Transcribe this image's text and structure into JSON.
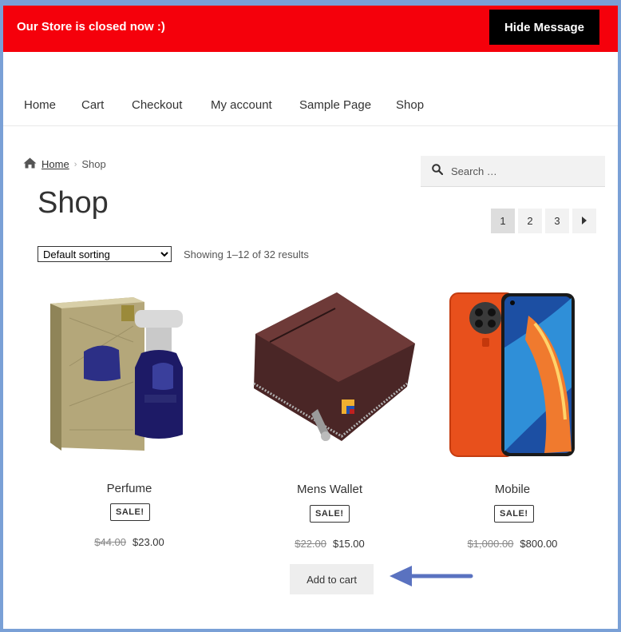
{
  "notice": {
    "message": "Our Store is closed now :)",
    "hide_button": "Hide Message",
    "bar_color": "#f5000b"
  },
  "nav": {
    "items": [
      {
        "label": "Home"
      },
      {
        "label": "Cart"
      },
      {
        "label": "Checkout"
      },
      {
        "label": "My account"
      },
      {
        "label": "Sample Page"
      },
      {
        "label": "Shop"
      }
    ]
  },
  "breadcrumb": {
    "home": "Home",
    "current": "Shop",
    "home_icon": "home-icon"
  },
  "search": {
    "placeholder": "Search …",
    "icon": "search-icon"
  },
  "page_title": "Shop",
  "pagination": {
    "pages": [
      "1",
      "2",
      "3"
    ],
    "current": "1",
    "next_icon": "triangle-right-icon"
  },
  "sorting": {
    "selected": "Default sorting"
  },
  "result_count": "Showing 1–12 of 32 results",
  "products": [
    {
      "title": "Perfume",
      "badge": "SALE!",
      "old_price": "$44.00",
      "price": "$23.00"
    },
    {
      "title": "Mens Wallet",
      "badge": "SALE!",
      "old_price": "$22.00",
      "price": "$15.00",
      "button": "Add to cart"
    },
    {
      "title": "Mobile",
      "badge": "SALE!",
      "old_price": "$1,000.00",
      "price": "$800.00"
    }
  ],
  "annotation": {
    "arrow_color": "#5a72c0"
  }
}
